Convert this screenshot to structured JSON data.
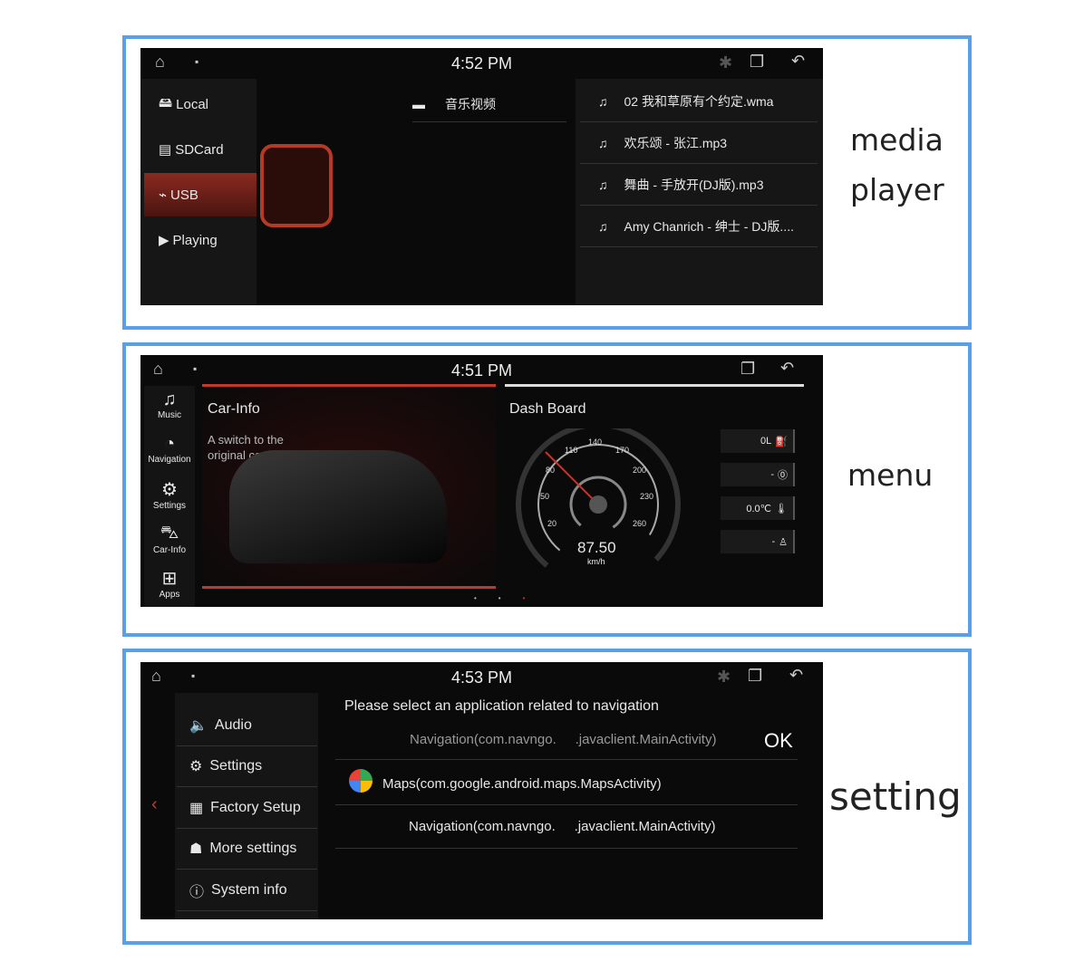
{
  "media": {
    "time": "4:52 PM",
    "caption1": "media",
    "caption2": "player",
    "sources": [
      {
        "label": "Local",
        "icon": "hard-drive-icon"
      },
      {
        "label": "SDCard",
        "icon": "sdcard-icon"
      },
      {
        "label": "USB",
        "icon": "usb-icon",
        "active": true
      },
      {
        "label": "Playing",
        "icon": "play-icon"
      }
    ],
    "folder": "音乐视频",
    "files": [
      "02 我和草原有个约定.wma",
      "欢乐颂 - 张江.mp3",
      "舞曲 - 手放开(DJ版).mp3",
      "Amy Chanrich - 绅士 - DJ版...."
    ]
  },
  "menu": {
    "time": "4:51 PM",
    "caption": "menu",
    "dock": [
      {
        "label": "Music",
        "icon": "music-icon"
      },
      {
        "label": "Navigation",
        "icon": "navigation-icon"
      },
      {
        "label": "Settings",
        "icon": "gear-icon"
      },
      {
        "label": "Car-Info",
        "icon": "car-icon"
      },
      {
        "label": "Apps",
        "icon": "apps-icon"
      }
    ],
    "carinfo_title": "Car-Info",
    "carinfo_desc1": "A switch to the",
    "carinfo_desc2": "original car interface",
    "dash_title": "Dash Board",
    "speed": "87.50",
    "speed_unit": "km/h",
    "ticks": [
      "20",
      "50",
      "80",
      "110",
      "140",
      "170",
      "200",
      "230",
      "260"
    ],
    "indicators": [
      {
        "value": "0L",
        "icon": "fuel-icon"
      },
      {
        "value": "-",
        "icon": "brake-icon"
      },
      {
        "value": "0.0℃",
        "icon": "thermometer-icon"
      },
      {
        "value": "-",
        "icon": "seatbelt-icon"
      }
    ],
    "accent": "#c0392b"
  },
  "setting": {
    "time": "4:53 PM",
    "caption": "setting",
    "items": [
      {
        "label": "Audio",
        "icon": "speaker-icon"
      },
      {
        "label": "Settings",
        "icon": "gear-icon"
      },
      {
        "label": "Factory Setup",
        "icon": "factory-icon"
      },
      {
        "label": "More settings",
        "icon": "android-icon"
      },
      {
        "label": "System info",
        "icon": "info-icon"
      }
    ],
    "prompt": "Please select an application related to navigation",
    "options": [
      "Navigation(com.navngo.     .javaclient.MainActivity)",
      "Maps(com.google.android.maps.MapsActivity)",
      "Navigation(com.navngo.     .javaclient.MainActivity)"
    ],
    "ok": "OK"
  }
}
